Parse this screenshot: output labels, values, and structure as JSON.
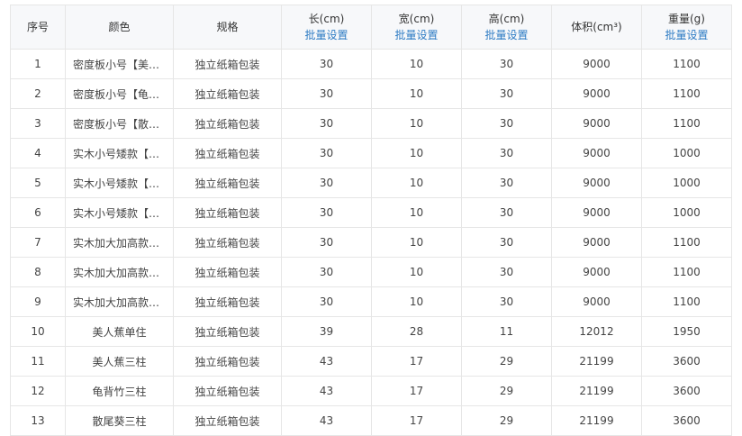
{
  "table": {
    "headers": {
      "index": "序号",
      "color": "颜色",
      "spec": "规格",
      "length": "长(cm)",
      "width": "宽(cm)",
      "height": "高(cm)",
      "volume": "体积(cm³)",
      "weight": "重量(g)",
      "batch_label": "批量设置"
    },
    "rows": [
      {
        "index": "1",
        "color": "密度板小号【美人蕉】",
        "spec": "独立纸箱包装",
        "length": "30",
        "width": "10",
        "height": "30",
        "volume": "9000",
        "weight": "1100"
      },
      {
        "index": "2",
        "color": "密度板小号【龟背竹】",
        "spec": "独立纸箱包装",
        "length": "30",
        "width": "10",
        "height": "30",
        "volume": "9000",
        "weight": "1100"
      },
      {
        "index": "3",
        "color": "密度板小号【散尾葵】",
        "spec": "独立纸箱包装",
        "length": "30",
        "width": "10",
        "height": "30",
        "volume": "9000",
        "weight": "1100"
      },
      {
        "index": "4",
        "color": "实木小号矮款【美人蕉】",
        "spec": "独立纸箱包装",
        "length": "30",
        "width": "10",
        "height": "30",
        "volume": "9000",
        "weight": "1000"
      },
      {
        "index": "5",
        "color": "实木小号矮款【龟背竹】",
        "spec": "独立纸箱包装",
        "length": "30",
        "width": "10",
        "height": "30",
        "volume": "9000",
        "weight": "1000"
      },
      {
        "index": "6",
        "color": "实木小号矮款【散尾葵】",
        "spec": "独立纸箱包装",
        "length": "30",
        "width": "10",
        "height": "30",
        "volume": "9000",
        "weight": "1000"
      },
      {
        "index": "7",
        "color": "实木加大加高款【美人蕉】",
        "spec": "独立纸箱包装",
        "length": "30",
        "width": "10",
        "height": "30",
        "volume": "9000",
        "weight": "1100"
      },
      {
        "index": "8",
        "color": "实木加大加高款【龟背竹】",
        "spec": "独立纸箱包装",
        "length": "30",
        "width": "10",
        "height": "30",
        "volume": "9000",
        "weight": "1100"
      },
      {
        "index": "9",
        "color": "实木加大加高款【散尾葵】",
        "spec": "独立纸箱包装",
        "length": "30",
        "width": "10",
        "height": "30",
        "volume": "9000",
        "weight": "1100"
      },
      {
        "index": "10",
        "color": "美人蕉单住",
        "spec": "独立纸箱包装",
        "length": "39",
        "width": "28",
        "height": "11",
        "volume": "12012",
        "weight": "1950"
      },
      {
        "index": "11",
        "color": "美人蕉三柱",
        "spec": "独立纸箱包装",
        "length": "43",
        "width": "17",
        "height": "29",
        "volume": "21199",
        "weight": "3600"
      },
      {
        "index": "12",
        "color": "龟背竹三柱",
        "spec": "独立纸箱包装",
        "length": "43",
        "width": "17",
        "height": "29",
        "volume": "21199",
        "weight": "3600"
      },
      {
        "index": "13",
        "color": "散尾葵三柱",
        "spec": "独立纸箱包装",
        "length": "43",
        "width": "17",
        "height": "29",
        "volume": "21199",
        "weight": "3600"
      }
    ]
  },
  "colors": {
    "link": "#2d7bc4",
    "header_bg": "#f7f8fa",
    "border": "#e6e6e6"
  }
}
